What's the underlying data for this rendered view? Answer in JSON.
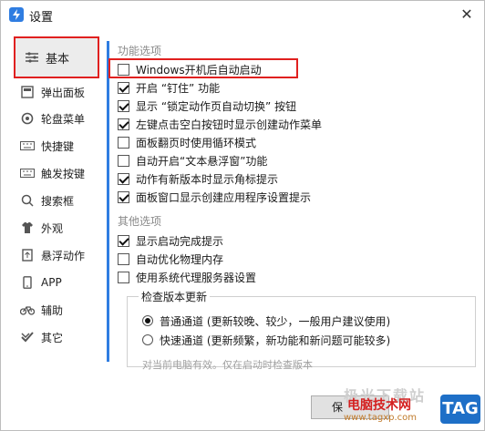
{
  "window": {
    "title": "设置",
    "close_label": "✕"
  },
  "sidebar": {
    "items": [
      {
        "label": "基本",
        "icon": "sliders-icon",
        "selected": true
      },
      {
        "label": "弹出面板",
        "icon": "panel-icon"
      },
      {
        "label": "轮盘菜单",
        "icon": "wheel-icon"
      },
      {
        "label": "快捷键",
        "icon": "keyboard-icon"
      },
      {
        "label": "触发按键",
        "icon": "keyboard-icon"
      },
      {
        "label": "搜索框",
        "icon": "search-icon"
      },
      {
        "label": "外观",
        "icon": "shirt-icon"
      },
      {
        "label": "悬浮动作",
        "icon": "float-icon"
      },
      {
        "label": "APP",
        "icon": "phone-icon"
      },
      {
        "label": "辅助",
        "icon": "bike-icon"
      },
      {
        "label": "其它",
        "icon": "check-icon"
      }
    ]
  },
  "sections": {
    "features_title": "功能选项",
    "features": [
      {
        "label": "Windows开机后自动启动",
        "checked": false
      },
      {
        "label": "开启 “钉住” 功能",
        "checked": true
      },
      {
        "label": "显示 “锁定动作页自动切换” 按钮",
        "checked": true
      },
      {
        "label": "左键点击空白按钮时显示创建动作菜单",
        "checked": true
      },
      {
        "label": "面板翻页时使用循环模式",
        "checked": false
      },
      {
        "label": "自动开启“文本悬浮窗”功能",
        "checked": false
      },
      {
        "label": "动作有新版本时显示角标提示",
        "checked": true
      },
      {
        "label": "面板窗口显示创建应用程序设置提示",
        "checked": true
      }
    ],
    "other_title": "其他选项",
    "other": [
      {
        "label": "显示启动完成提示",
        "checked": true
      },
      {
        "label": "自动优化物理内存",
        "checked": false
      },
      {
        "label": "使用系统代理服务器设置",
        "checked": false
      }
    ],
    "update": {
      "legend": "检查版本更新",
      "options": [
        {
          "label": "普通通道 (更新较晚、较少，一般用户建议使用)",
          "selected": true
        },
        {
          "label": "快速通道 (更新频繁，新功能和新问题可能较多)",
          "selected": false
        }
      ],
      "note": "对当前电脑有效。仅在启动时检查版本"
    }
  },
  "footer": {
    "save_label": "保"
  },
  "watermark": {
    "top": "极光下载站",
    "main": "电脑技术网",
    "url": "www.tagxp.com",
    "tag": "TAG"
  }
}
